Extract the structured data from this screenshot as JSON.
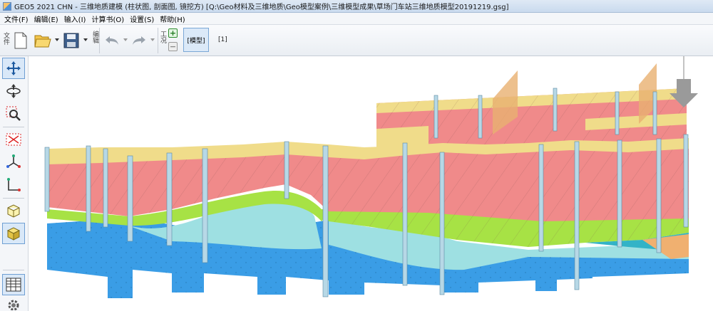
{
  "window": {
    "title": "GEO5 2021 CHN - 三维地质建模 (柱状图, 剖面图, 镜挖方) [Q:\\Geo材料及三维地质\\Geo模型案例\\三维模型成果\\草场门车站三维地质模型20191219.gsg]"
  },
  "menu": {
    "items": [
      {
        "label": "文件(F)"
      },
      {
        "label": "编辑(E)"
      },
      {
        "label": "输入(I)"
      },
      {
        "label": "计算书(O)"
      },
      {
        "label": "设置(S)"
      },
      {
        "label": "帮助(H)"
      }
    ]
  },
  "toolbar": {
    "file_label": "文件",
    "edit_label": "编辑",
    "stage_label": "工况",
    "model_tab": "[模型]",
    "stage_number": "[1]"
  },
  "icons": {
    "sidebar": [
      "move-arrows-icon",
      "rotate-view-icon",
      "zoom-icon",
      "zoom-extents-icon",
      "axis-view-icon",
      "xy-axis-icon",
      "wire-box-icon",
      "solid-box-icon",
      "table-icon",
      "settings-gear-icon"
    ]
  },
  "colors": {
    "fill_layer": "#f0dc8a",
    "clay_layer": "#f08a8a",
    "silt_layer": "#a7e245",
    "sand_layer": "#9ee0e2",
    "rock_layer": "#3a9de6",
    "borehole": "#b7d8e6"
  }
}
